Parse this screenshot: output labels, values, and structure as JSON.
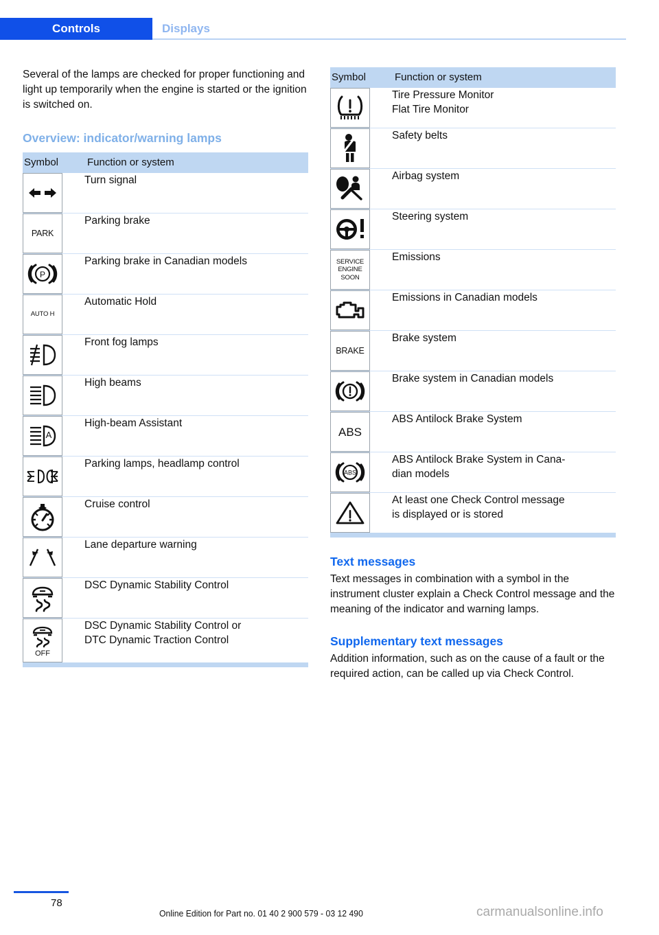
{
  "header": {
    "tab_active": "Controls",
    "tab_inactive": "Displays",
    "accent_blue": "#1050e8",
    "muted_blue": "#8fb6f0"
  },
  "left": {
    "intro": "Several of the lamps are checked for proper functioning and light up temporarily when the engine is started or the ignition is switched on.",
    "heading": "Overview: indicator/warning lamps",
    "table": {
      "columns": [
        "Symbol",
        "Function or system"
      ],
      "rows": [
        {
          "icon": "turn-signal-icon",
          "text": "Turn signal"
        },
        {
          "icon": "park-text-icon",
          "text": "Parking brake"
        },
        {
          "icon": "parking-brake-canadian-icon",
          "text": "Parking brake in Canadian models"
        },
        {
          "icon": "auto-hold-icon",
          "text": "Automatic Hold"
        },
        {
          "icon": "front-fog-lamp-icon",
          "text": "Front fog lamps"
        },
        {
          "icon": "high-beam-icon",
          "text": "High beams"
        },
        {
          "icon": "high-beam-assistant-icon",
          "text": "High-beam Assistant"
        },
        {
          "icon": "parking-lamps-headlamp-icon",
          "text": "Parking lamps, headlamp control"
        },
        {
          "icon": "cruise-control-icon",
          "text": "Cruise control"
        },
        {
          "icon": "lane-departure-warning-icon",
          "text": "Lane departure warning"
        },
        {
          "icon": "dsc-icon",
          "text": "DSC Dynamic Stability Control"
        },
        {
          "icon": "dsc-off-icon",
          "text": "DSC Dynamic Stability Control or",
          "text2": "DTC Dynamic Traction Control"
        }
      ]
    }
  },
  "right": {
    "table": {
      "columns": [
        "Symbol",
        "Function or system"
      ],
      "rows": [
        {
          "icon": "tire-pressure-monitor-icon",
          "text": "Tire Pressure Monitor",
          "text2": "Flat Tire Monitor"
        },
        {
          "icon": "safety-belt-icon",
          "text": "Safety belts"
        },
        {
          "icon": "airbag-icon",
          "text": "Airbag system"
        },
        {
          "icon": "steering-system-icon",
          "text": "Steering system"
        },
        {
          "icon": "service-engine-soon-icon",
          "text": "Emissions"
        },
        {
          "icon": "check-engine-icon",
          "text": "Emissions in Canadian models"
        },
        {
          "icon": "brake-text-icon",
          "text": "Brake system"
        },
        {
          "icon": "brake-canadian-icon",
          "text": "Brake system in Canadian models"
        },
        {
          "icon": "abs-text-icon",
          "text": "ABS Antilock Brake System"
        },
        {
          "icon": "abs-canadian-icon",
          "text": "ABS Antilock Brake System in Cana-",
          "text2": "dian models"
        },
        {
          "icon": "check-control-warning-icon",
          "text": "At least one Check Control message",
          "text2": "is displayed or is stored"
        }
      ]
    },
    "section1_heading": "Text messages",
    "section1_body": "Text messages in combination with a symbol in the instrument cluster explain a Check Control message and the meaning of the indicator and warning lamps.",
    "section2_heading": "Supplementary text messages",
    "section2_body": "Addition information, such as on the cause of a fault or the required action, can be called up via Check Control."
  },
  "symbol_labels": {
    "park": "PARK",
    "auto_h": "AUTO H",
    "service_line1": "SERVICE",
    "service_line2": "ENGINE",
    "service_line3": "SOON",
    "brake": "BRAKE",
    "abs": "ABS",
    "abs_small": "ABS",
    "p": "P",
    "off": "OFF"
  },
  "footer": {
    "page_number": "78",
    "edition_line": "Online Edition for Part no. 01 40 2 900 579 - 03 12 490",
    "watermark": "carmanualsonline.info"
  }
}
